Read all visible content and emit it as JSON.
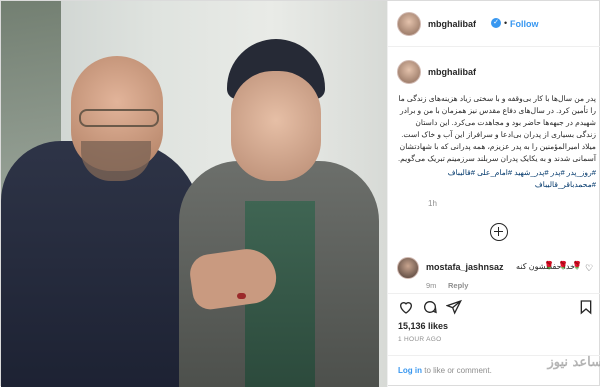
{
  "post": {
    "username": "mbghalibaf",
    "follow_label": "Follow",
    "dot": "•",
    "caption": "پدر من سال‌ها با کار بی‌وقفه و با سختی زیاد هزینه‌های زندگی ما را تأمین کرد. در سال‌های دفاع مقدس نیز همزمان با من و برادر شهیدم در جبهه‌ها حاضر بود و مجاهدت می‌کرد. این داستان زندگی بسیاری از پدران بی‌ادعا و سرافراز این آب و خاک است. میلاد امیرالمؤمنین را به پدر عزیزم، همه پدرانی که با شهادتشان آسمانی شدند و به یکایک پدران سربلند سرزمینم تبریک می‌گویم.",
    "hashtags": "#روز_پدر #پدر #پدر_شهید #امام_علی #قالیباف #محمدباقر_قالیباف",
    "time": "1h",
    "likes": "15,136 likes",
    "date": "1 HOUR AGO"
  },
  "comment": {
    "username": "mostafa_jashnsaz",
    "text": "خدا حفظشون کنه",
    "hearts": "🌹 🌹 🌹",
    "time": "9m",
    "reply": "Reply"
  },
  "footer": {
    "login_link": "Log in",
    "login_rest": " to like or comment.",
    "watermark": "ساعد نیوز"
  }
}
